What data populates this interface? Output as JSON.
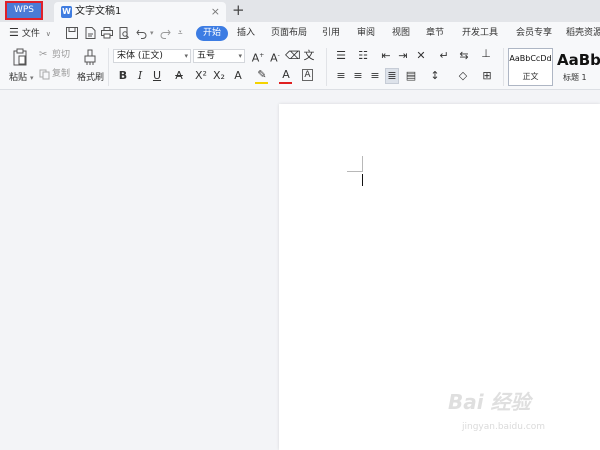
{
  "app": {
    "brand_tab": "WPS"
  },
  "document_tab": {
    "icon_letter": "W",
    "title": "文字文稿1",
    "close": "×"
  },
  "new_tab": "+",
  "menu": {
    "file": "文件",
    "tabs": [
      "开始",
      "插入",
      "页面布局",
      "引用",
      "审阅",
      "视图",
      "章节",
      "开发工具",
      "会员专享",
      "稻壳资源"
    ]
  },
  "ribbon": {
    "paste": "粘贴",
    "cut": "剪切",
    "copy": "复制",
    "format_painter": "格式刷",
    "font_name": "宋体 (正文)",
    "font_size": "五号",
    "styles": [
      {
        "preview": "AaBbCcDd",
        "name": "正文"
      },
      {
        "preview": "AaBb",
        "name": "标题 1"
      }
    ]
  },
  "watermark": {
    "text": "Bai 经验",
    "url": "jingyan.baidu.com"
  },
  "colors": {
    "accent": "#3c7ce3",
    "brand_tab_bg": "#4b7bd6",
    "highlight_border": "#e0202a",
    "font_color_bar": "#e02020",
    "highlight_bar": "#f5d300"
  }
}
